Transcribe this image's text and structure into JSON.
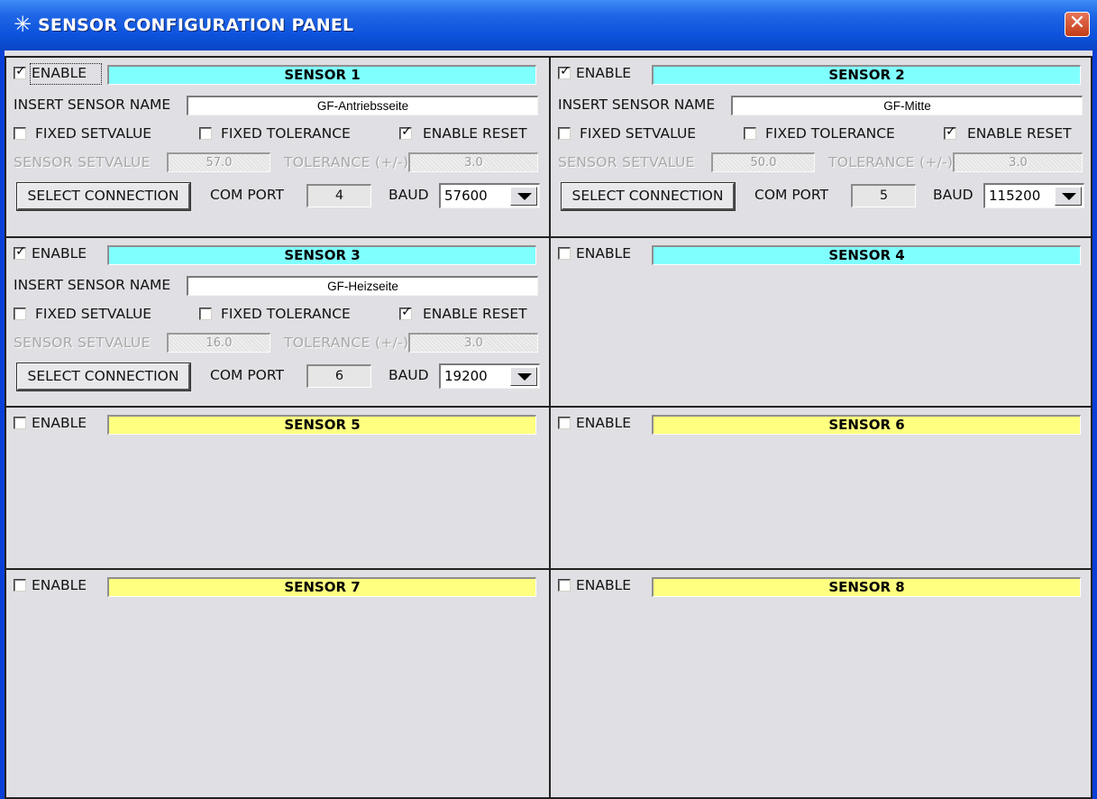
{
  "window": {
    "title": "SENSOR CONFIGURATION PANEL",
    "close_glyph": "✕",
    "title_icon": "sparkle-icon"
  },
  "labels": {
    "enable": "ENABLE",
    "insert_name": "INSERT SENSOR NAME",
    "fixed_setvalue": "FIXED SETVALUE",
    "fixed_tolerance": "FIXED TOLERANCE",
    "enable_reset": "ENABLE RESET",
    "setvalue": "SENSOR SETVALUE",
    "tolerance": "TOLERANCE (+/-)",
    "select_connection": "SELECT CONNECTION",
    "com_port": "COM PORT",
    "baud": "BAUD"
  },
  "colors": {
    "cyan_banner": "#80ffff",
    "yellow_banner": "#ffff80",
    "title_bar": "#0c52dc"
  },
  "sensors": [
    {
      "title": "SENSOR 1",
      "enabled": true,
      "name": "GF-Antriebsseite",
      "fixed_setvalue": false,
      "fixed_tolerance": false,
      "enable_reset": true,
      "setvalue": "57.0",
      "tolerance": "3.0",
      "com_port": "4",
      "baud": "57600"
    },
    {
      "title": "SENSOR 2",
      "enabled": true,
      "name": "GF-Mitte",
      "fixed_setvalue": false,
      "fixed_tolerance": false,
      "enable_reset": true,
      "setvalue": "50.0",
      "tolerance": "3.0",
      "com_port": "5",
      "baud": "115200"
    },
    {
      "title": "SENSOR 3",
      "enabled": true,
      "name": "GF-Heizseite",
      "fixed_setvalue": false,
      "fixed_tolerance": false,
      "enable_reset": true,
      "setvalue": "16.0",
      "tolerance": "3.0",
      "com_port": "6",
      "baud": "19200"
    },
    {
      "title": "SENSOR 4",
      "enabled": false
    },
    {
      "title": "SENSOR 5",
      "enabled": false
    },
    {
      "title": "SENSOR 6",
      "enabled": false
    },
    {
      "title": "SENSOR 7",
      "enabled": false
    },
    {
      "title": "SENSOR 8",
      "enabled": false
    }
  ]
}
